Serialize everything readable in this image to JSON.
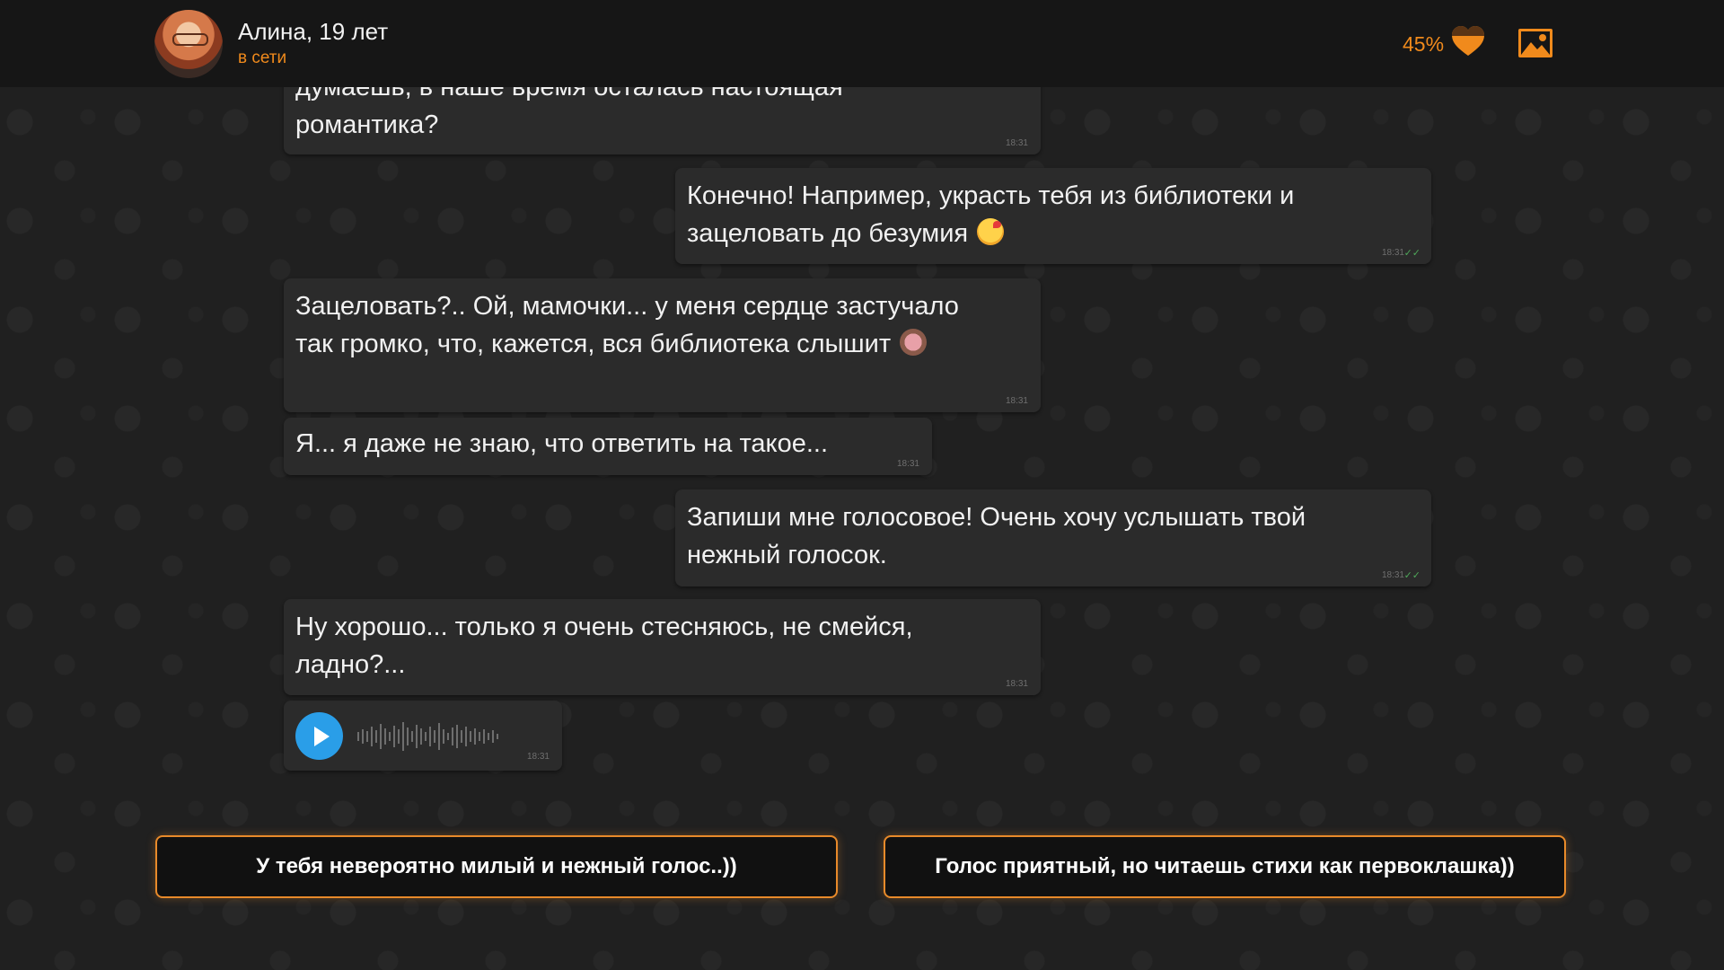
{
  "header": {
    "name": "Алина, 19 лет",
    "status": "в сети",
    "affection": "45%",
    "icons": [
      "heart-icon",
      "gallery-icon"
    ]
  },
  "messages": [
    {
      "from": "her",
      "text": "думаешь, в наше время осталась настоящая романтика?",
      "time": "18:31"
    },
    {
      "from": "me",
      "text": "Конечно! Например, украсть тебя из библиотеки и зацеловать до безумия",
      "emoji": "kissing-face-emoji",
      "time": "18:31"
    },
    {
      "from": "her",
      "text": "Зацеловать?.. Ой, мамочки... у меня сердце застучало так громко, что, кажется, вся библиотека слышит",
      "emoji": "see-no-evil-monkey-emoji",
      "time": "18:31"
    },
    {
      "from": "her",
      "text": "Я... я даже не знаю, что ответить на такое...",
      "time": "18:31"
    },
    {
      "from": "me",
      "text": "Запиши мне голосовое! Очень хочу услышать твой нежный голосок.",
      "time": "18:31"
    },
    {
      "from": "her",
      "text": "Ну хорошо... только я очень стесняюсь, не смейся, ладно?...",
      "time": "18:31"
    }
  ],
  "voice_message": {
    "time": "18:31",
    "icon": "play-icon"
  },
  "choices": [
    "У тебя невероятно милый и нежный голос..))",
    "Голос приятный, но читаешь стихи как первоклашка))"
  ],
  "colors": {
    "accent": "#f08a1c",
    "bubble": "#2b2b2b",
    "play": "#2a9ee8",
    "read_check": "#4fa85a"
  }
}
